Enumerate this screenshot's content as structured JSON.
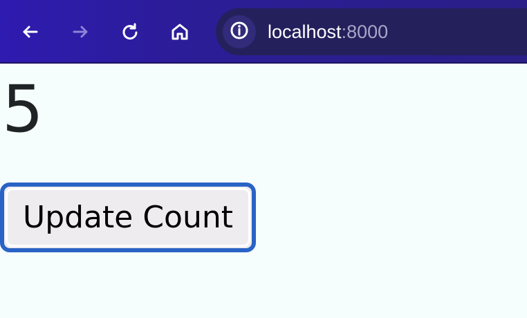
{
  "browser": {
    "url_host": "localhost",
    "url_port": ":8000",
    "icons": {
      "back": "arrow-left-icon",
      "forward": "arrow-right-icon",
      "reload": "reload-icon",
      "home": "home-icon",
      "site_info": "info-icon"
    },
    "colors": {
      "toolbar": "#2e1bb0",
      "url_bar": "#24205c",
      "page_bg": "#f6fdfd",
      "focus_ring": "#2a63c6"
    }
  },
  "page": {
    "count": "5",
    "button_label": "Update Count"
  }
}
